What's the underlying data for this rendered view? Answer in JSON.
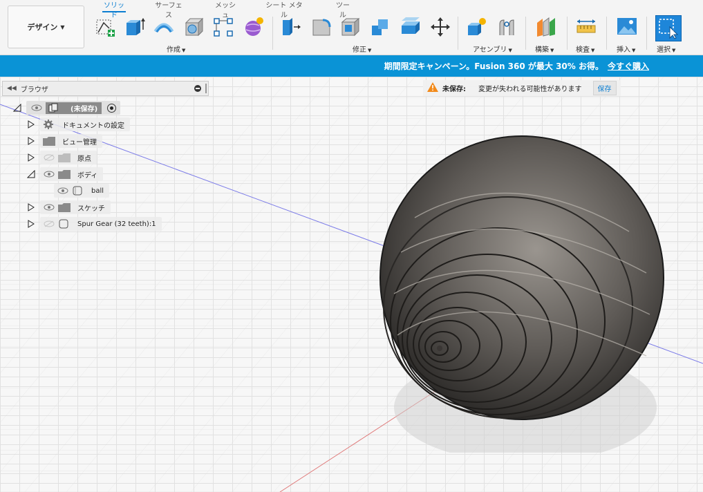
{
  "app": {
    "workspace_label": "デザイン"
  },
  "tabs": [
    {
      "label": "ソリッド",
      "active": true
    },
    {
      "label": "サーフェス",
      "active": false
    },
    {
      "label": "メッシュ",
      "active": false
    },
    {
      "label": "シート メタル",
      "active": false
    },
    {
      "label": "ツール",
      "active": false
    }
  ],
  "groups": {
    "create": "作成",
    "modify": "修正",
    "assemble": "アセンブリ",
    "construct": "構築",
    "inspect": "検査",
    "insert": "挿入",
    "select": "選択"
  },
  "banner": {
    "text": "期間限定キャンペーン。Fusion 360 が最大 30% お得。",
    "link": "今すぐ購入"
  },
  "browser": {
    "title": "ブラウザ",
    "root": "(未保存)",
    "items": [
      {
        "label": "ドキュメントの設定"
      },
      {
        "label": "ビュー管理"
      },
      {
        "label": "原点"
      },
      {
        "label": "ボディ"
      },
      {
        "label": "ball"
      },
      {
        "label": "スケッチ"
      },
      {
        "label": "Spur Gear (32 teeth):1"
      }
    ]
  },
  "unsaved": {
    "title": "未保存:",
    "message": "変更が失われる可能性があります",
    "save_label": "保存"
  },
  "colors": {
    "accent": "#0a93d6",
    "tab_active": "#0a7dd1",
    "body": "#6e6a66"
  }
}
